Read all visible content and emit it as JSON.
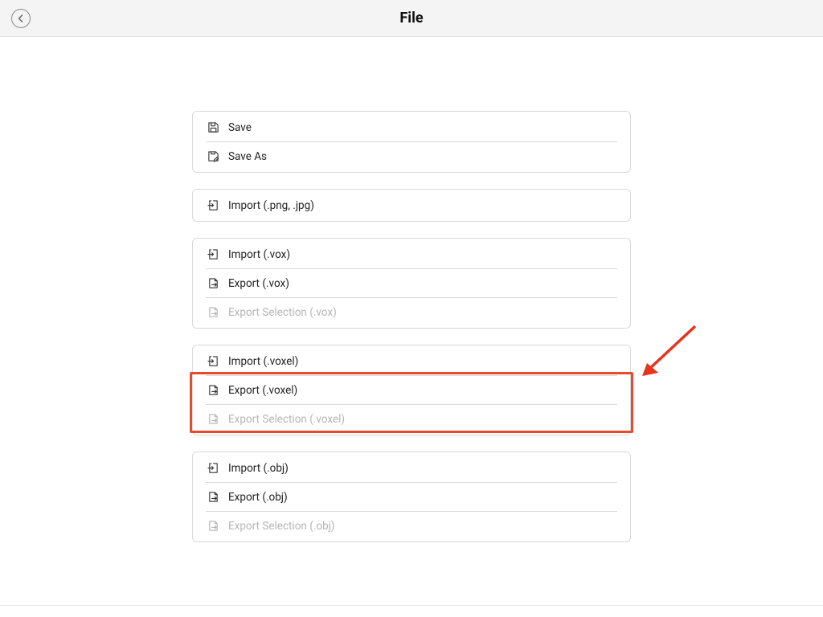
{
  "header": {
    "title": "File"
  },
  "groups": [
    {
      "items": [
        {
          "label": "Save",
          "icon": "save",
          "disabled": false
        },
        {
          "label": "Save As",
          "icon": "save-as",
          "disabled": false
        }
      ]
    },
    {
      "items": [
        {
          "label": "Import (.png, .jpg)",
          "icon": "import",
          "disabled": false
        }
      ]
    },
    {
      "items": [
        {
          "label": "Import (.vox)",
          "icon": "import",
          "disabled": false
        },
        {
          "label": "Export (.vox)",
          "icon": "export",
          "disabled": false
        },
        {
          "label": "Export Selection (.vox)",
          "icon": "export",
          "disabled": true
        }
      ]
    },
    {
      "items": [
        {
          "label": "Import (.voxel)",
          "icon": "import",
          "disabled": false
        },
        {
          "label": "Export (.voxel)",
          "icon": "export",
          "disabled": false
        },
        {
          "label": "Export Selection (.voxel)",
          "icon": "export",
          "disabled": true
        }
      ]
    },
    {
      "items": [
        {
          "label": "Import (.obj)",
          "icon": "import",
          "disabled": false
        },
        {
          "label": "Export (.obj)",
          "icon": "export",
          "disabled": false
        },
        {
          "label": "Export Selection (.obj)",
          "icon": "export",
          "disabled": true
        }
      ]
    }
  ]
}
